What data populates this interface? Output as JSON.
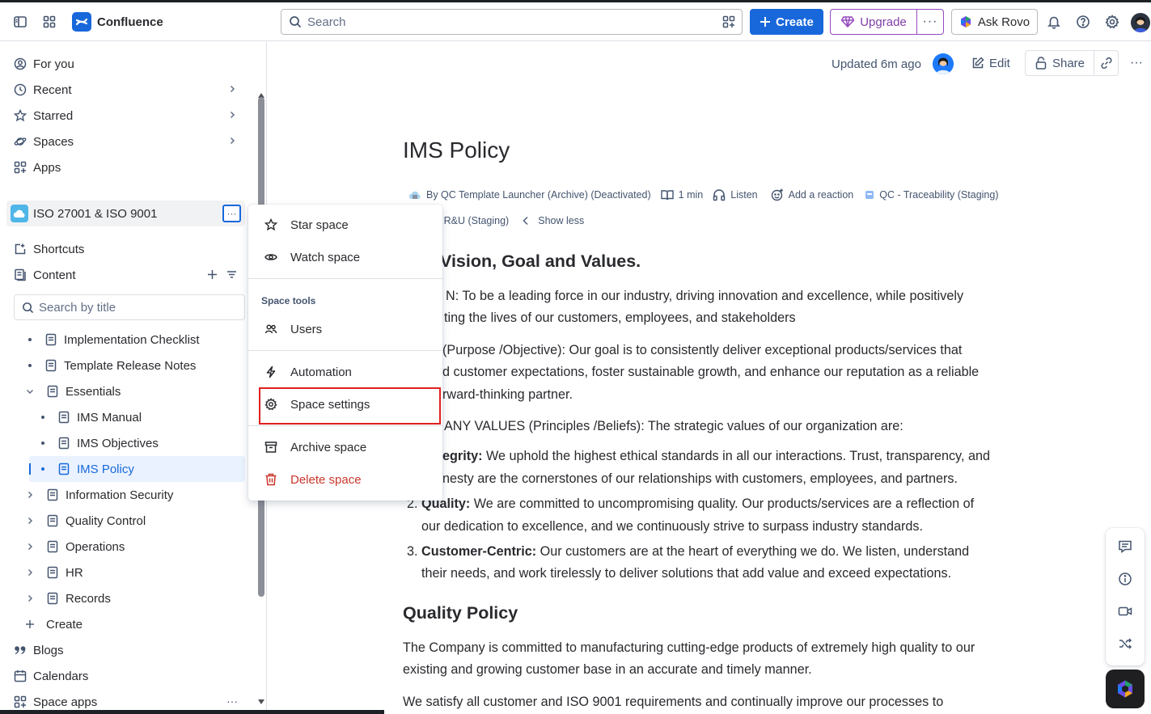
{
  "app": {
    "name": "Confluence",
    "accent": "#1868db"
  },
  "topbar": {
    "search_placeholder": "Search",
    "create_label": "Create",
    "upgrade_label": "Upgrade",
    "rovo_label": "Ask Rovo",
    "icons": [
      "sidebar-toggle-icon",
      "app-switcher-icon",
      "bell-icon",
      "help-icon",
      "settings-icon"
    ]
  },
  "sidebar": {
    "nav": [
      {
        "label": "For you",
        "icon": "user-circle-icon"
      },
      {
        "label": "Recent",
        "icon": "clock-icon"
      },
      {
        "label": "Starred",
        "icon": "star-icon"
      },
      {
        "label": "Spaces",
        "icon": "planet-icon"
      },
      {
        "label": "Apps",
        "icon": "apps-icon"
      }
    ],
    "space_name": "ISO 27001 & ISO 9001",
    "shortcuts_label": "Shortcuts",
    "content_label": "Content",
    "search_placeholder": "Search by title",
    "tree": [
      {
        "label": "Implementation Checklist"
      },
      {
        "label": "Template Release Notes"
      },
      {
        "label": "Essentials"
      },
      {
        "label": "IMS Manual"
      },
      {
        "label": "IMS Objectives"
      },
      {
        "label": "IMS Policy"
      },
      {
        "label": "Information Security"
      },
      {
        "label": "Quality Control"
      },
      {
        "label": "Operations"
      },
      {
        "label": "HR"
      },
      {
        "label": "Records"
      }
    ],
    "create_label": "Create",
    "blogs_label": "Blogs",
    "calendars_label": "Calendars",
    "space_apps_label": "Space apps"
  },
  "menu": {
    "star_space": "Star space",
    "watch_space": "Watch space",
    "section_label": "Space tools",
    "users": "Users",
    "automation": "Automation",
    "space_settings": "Space settings",
    "archive_space": "Archive space",
    "delete_space": "Delete space"
  },
  "page": {
    "updated": "Updated 6m ago",
    "edit_label": "Edit",
    "share_label": "Share",
    "title": "IMS Policy",
    "byline": {
      "author": "By QC Template Launcher (Archive) (Deactivated)",
      "read_time": "1 min",
      "listen": "Listen",
      "reaction": "Add a reaction",
      "label1": "QC - Traceability (Staging)",
      "label2": "- R&U (Staging)",
      "show_less": "Show less"
    },
    "heading1": "Vision, Goal and Values.",
    "vision_l1": "N: To be a leading force in our industry, driving innovation and excellence, while positively",
    "vision_l2": "ting the lives of our customers, employees, and stakeholders",
    "goal_l1": "(Purpose /Objective): Our goal is to consistently deliver exceptional products/services that",
    "goal_l2": "d customer expectations, foster sustainable growth, and enhance our reputation as a reliable",
    "goal_l3": "rward-thinking partner.",
    "values_intro": "ANY VALUES (Principles /Beliefs): The strategic values of our organization are:",
    "value1_term": "egrity:",
    "value1_l1": " We uphold the highest ethical standards in all our interactions. Trust, transparency, and",
    "value1_l2": "nesty are the cornerstones of our relationships with customers, employees, and partners.",
    "value2_num": "2.",
    "value2_term": "Quality:",
    "value2_l1": " We are committed to uncompromising quality. Our products/services are a reflection of",
    "value2_l2": "our dedication to excellence, and we continuously strive to surpass industry standards.",
    "value3_num": "3.",
    "value3_term": "Customer-Centric:",
    "value3_l1": " Our customers are at the heart of everything we do. We listen, understand",
    "value3_l2": "their needs, and work tirelessly to deliver solutions that add value and exceed expectations.",
    "heading2": "Quality Policy",
    "qp_l1": "The Company is committed to manufacturing cutting-edge products of extremely high quality to our",
    "qp_l2": "existing and growing customer base in an accurate and timely manner.",
    "qp_l3": "We satisfy all customer and ISO 9001 requirements and continually improve our processes to"
  }
}
